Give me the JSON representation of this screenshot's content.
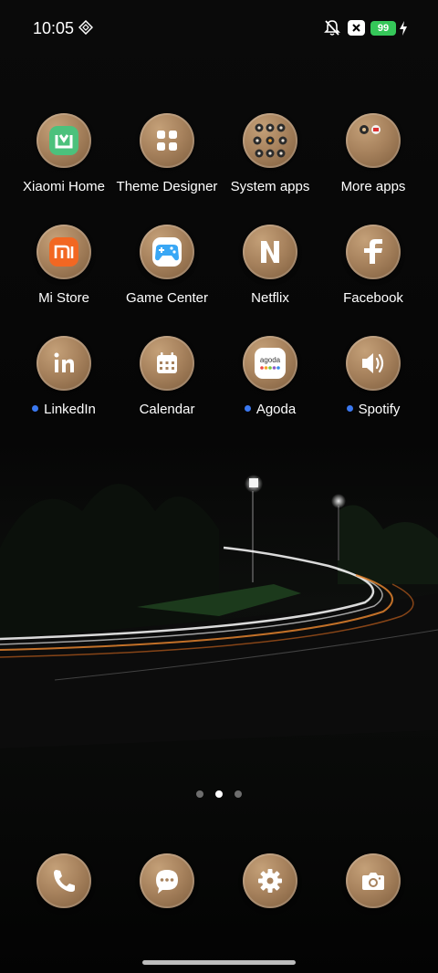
{
  "status_bar": {
    "time": "10:05",
    "battery_level": "99",
    "icons": [
      "nfc-icon",
      "mute-icon",
      "x-box-icon",
      "battery-icon",
      "charging-icon"
    ]
  },
  "apps": [
    {
      "label": "Xiaomi Home",
      "icon": "xiaomi-home-icon",
      "new": false
    },
    {
      "label": "Theme Designer",
      "icon": "theme-designer-icon",
      "new": false
    },
    {
      "label": "System apps",
      "icon": "system-apps-folder-icon",
      "new": false
    },
    {
      "label": "More apps",
      "icon": "more-apps-folder-icon",
      "new": false
    },
    {
      "label": "Mi Store",
      "icon": "mi-store-icon",
      "new": false
    },
    {
      "label": "Game Center",
      "icon": "game-center-icon",
      "new": false
    },
    {
      "label": "Netflix",
      "icon": "netflix-icon",
      "new": false
    },
    {
      "label": "Facebook",
      "icon": "facebook-icon",
      "new": false
    },
    {
      "label": "LinkedIn",
      "icon": "linkedin-icon",
      "new": true
    },
    {
      "label": "Calendar",
      "icon": "calendar-icon",
      "new": false
    },
    {
      "label": "Agoda",
      "icon": "agoda-icon",
      "new": true
    },
    {
      "label": "Spotify",
      "icon": "spotify-icon",
      "new": true
    }
  ],
  "agoda_logo_text": "agoda",
  "page_indicator": {
    "count": 3,
    "active": 2
  },
  "dock": [
    {
      "icon": "phone-icon"
    },
    {
      "icon": "messages-icon"
    },
    {
      "icon": "settings-icon"
    },
    {
      "icon": "camera-icon"
    }
  ],
  "colors": {
    "icon_bronze": "#a7825d",
    "new_dot": "#3a78f0",
    "battery": "#35c759",
    "xiaomi_green": "#4cc17c",
    "mi_orange": "#f26722",
    "game_blue": "#39a7f5"
  }
}
